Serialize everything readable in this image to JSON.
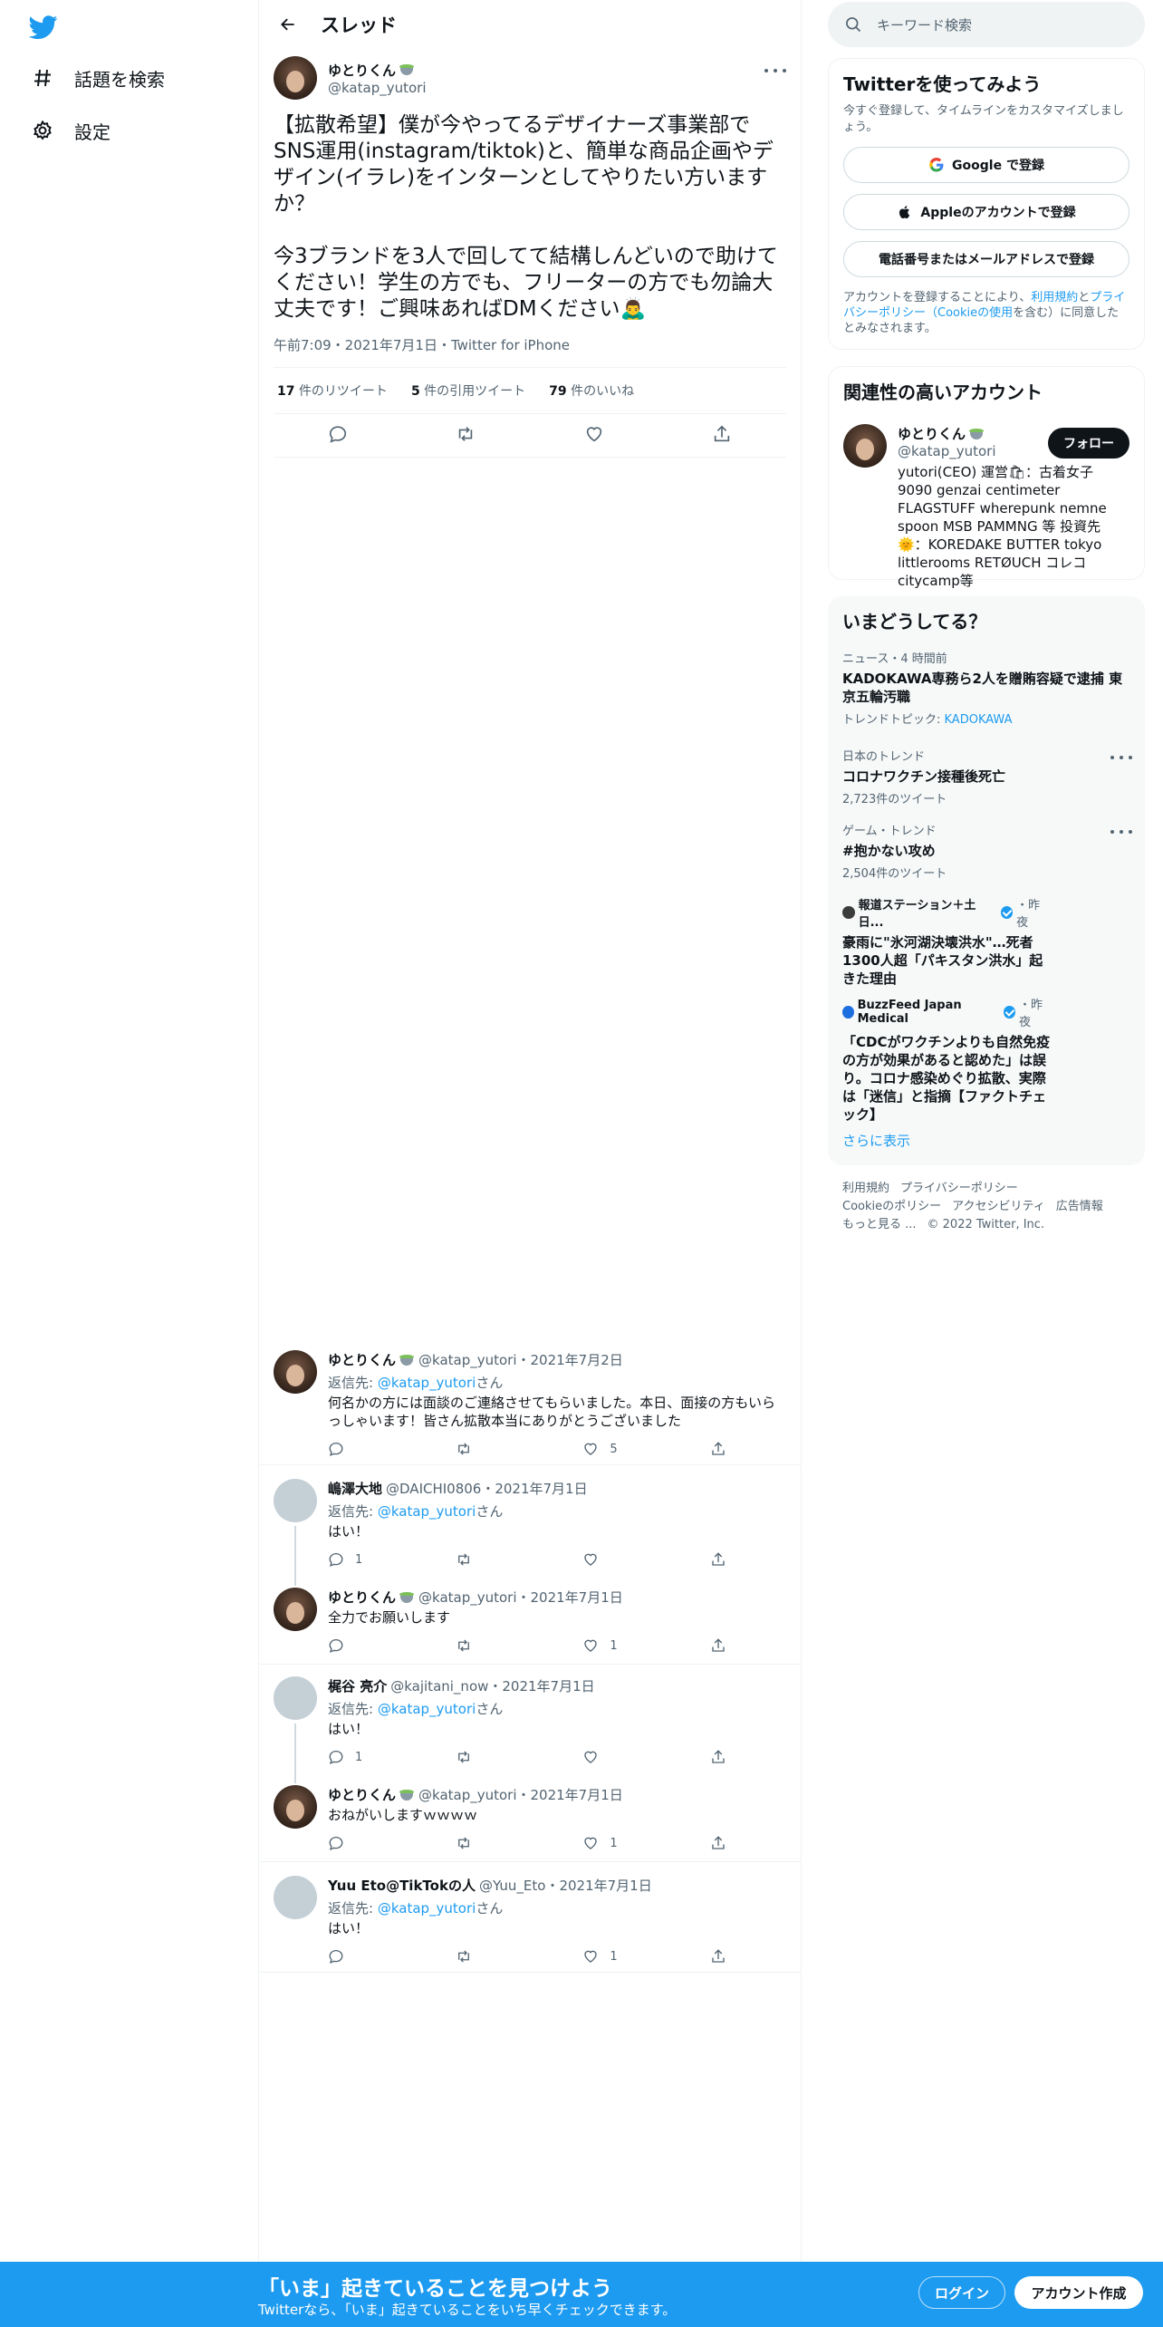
{
  "nav": {
    "explore_label": "話題を検索",
    "settings_label": "設定"
  },
  "header": {
    "title": "スレッド"
  },
  "main_tweet": {
    "name": "ゆとりくん",
    "handle": "@katap_yutori",
    "text": "【拡散希望】僕が今やってるデザイナーズ事業部でSNS運用(instagram/tiktok)と、簡単な商品企画やデザイン(イラレ)をインターンとしてやりたい方いますか？\n\n今3ブランドを3人で回してて結構しんどいので助けてください！学生の方でも、フリーターの方でも勿論大丈夫です！ご興味あればDMください🙇‍♂️",
    "meta": "午前7:09・2021年7月1日・Twitter for iPhone",
    "retweets": "17",
    "retweets_label": "件のリツイート",
    "quotes": "5",
    "quotes_label": "件の引用ツイート",
    "likes": "79",
    "likes_label": "件のいいね"
  },
  "replies": [
    {
      "name": "ゆとりくん",
      "handle": "@katap_yutori・2021年7月2日",
      "replying_prefix": "返信先: ",
      "replying_to": "@katap_yutori",
      "replying_suffix": "さん",
      "text": "何名かの方には面談のご連絡させてもらいました。本日、面接の方もいらっしゃいます！皆さん拡散本当にありがとうございました",
      "replies": "",
      "likes": "5"
    },
    {
      "name": "嶋澤大地",
      "handle": "@DAICHI0806・2021年7月1日",
      "replying_prefix": "返信先: ",
      "replying_to": "@katap_yutori",
      "replying_suffix": "さん",
      "text": "はい！",
      "replies": "1",
      "likes": ""
    },
    {
      "name": "ゆとりくん",
      "handle": "@katap_yutori・2021年7月1日",
      "text": "全力でお願いします",
      "replies": "",
      "likes": "1"
    },
    {
      "name": "梶谷 亮介",
      "handle": "@kajitani_now・2021年7月1日",
      "replying_prefix": "返信先: ",
      "replying_to": "@katap_yutori",
      "replying_suffix": "さん",
      "text": "はい！",
      "replies": "1",
      "likes": ""
    },
    {
      "name": "ゆとりくん",
      "handle": "@katap_yutori・2021年7月1日",
      "text": "おねがいしますｗｗｗｗ",
      "replies": "",
      "likes": "1"
    },
    {
      "name": "Yuu Eto@TikTokの人",
      "handle": "@Yuu_Eto・2021年7月1日",
      "replying_prefix": "返信先: ",
      "replying_to": "@katap_yutori",
      "replying_suffix": "さん",
      "text": "はい！",
      "replies": "",
      "likes": "1"
    }
  ],
  "search": {
    "placeholder": "キーワード検索"
  },
  "signup_card": {
    "title": "Twitterを使ってみよう",
    "subtitle": "今すぐ登録して、タイムラインをカスタマイズしましょう。",
    "google": "Google で登録",
    "apple": "Appleのアカウントで登録",
    "phone": "電話番号またはメールアドレスで登録",
    "legal_prefix": "アカウントを登録することにより、",
    "legal_terms": "利用規約",
    "legal_and": "と",
    "legal_privacy": "プライバシーポリシー（Cookieの使用",
    "legal_suffix": "を含む）に同意したとみなされます。"
  },
  "related": {
    "title": "関連性の高いアカウント",
    "name": "ゆとりくん",
    "handle": "@katap_yutori",
    "follow": "フォロー",
    "bio": "yutori(CEO) 運営🛍：古着女子 9090 genzai centimeter FLAGSTUFF wherepunk nemne spoon MSB PAMMNG 等 投資先🌞：KOREDAKE BUTTER tokyo littlerooms RETØUCH コレコ citycamp等"
  },
  "trends": {
    "title": "いまどうしてる？",
    "items": [
      {
        "context": "ニュース・4 時間前",
        "title": "KADOKAWA専務ら2人を贈賄容疑で逮捕 東京五輪汚職",
        "extra_prefix": "トレンドトピック: ",
        "extra_link": "KADOKAWA"
      },
      {
        "context": "日本のトレンド",
        "title": "コロナワクチン接種後死亡",
        "count": "2,723件のツイート"
      },
      {
        "context": "ゲーム・トレンド",
        "title": "#抱かない攻め",
        "count": "2,504件のツイート"
      },
      {
        "source": "報道ステーション＋土日...",
        "time": "・昨夜",
        "title": "豪雨に\"氷河湖決壊洪水\"…死者1300人超「パキスタン洪水」起きた理由"
      },
      {
        "source": "BuzzFeed Japan Medical",
        "time": "・昨夜",
        "title": "「CDCがワクチンよりも自然免疫の方が効果があると認めた」は誤り。コロナ感染めぐり拡散、実際は「迷信」と指摘【ファクトチェック】"
      }
    ],
    "show_more": "さらに表示"
  },
  "footer": {
    "terms": "利用規約",
    "privacy": "プライバシーポリシー",
    "cookie": "Cookieのポリシー",
    "accessibility": "アクセシビリティ",
    "ads": "広告情報",
    "more": "もっと見る ...",
    "copyright": "© 2022 Twitter, Inc."
  },
  "bottom_bar": {
    "title": "「いま」起きていることを見つけよう",
    "subtitle": "Twitterなら、「いま」起きていることをいち早くチェックできます。",
    "login": "ログイン",
    "signup": "アカウント作成"
  },
  "colors": {
    "accent": "#1d9bf0",
    "text": "#0f1419",
    "secondary": "#536471"
  }
}
